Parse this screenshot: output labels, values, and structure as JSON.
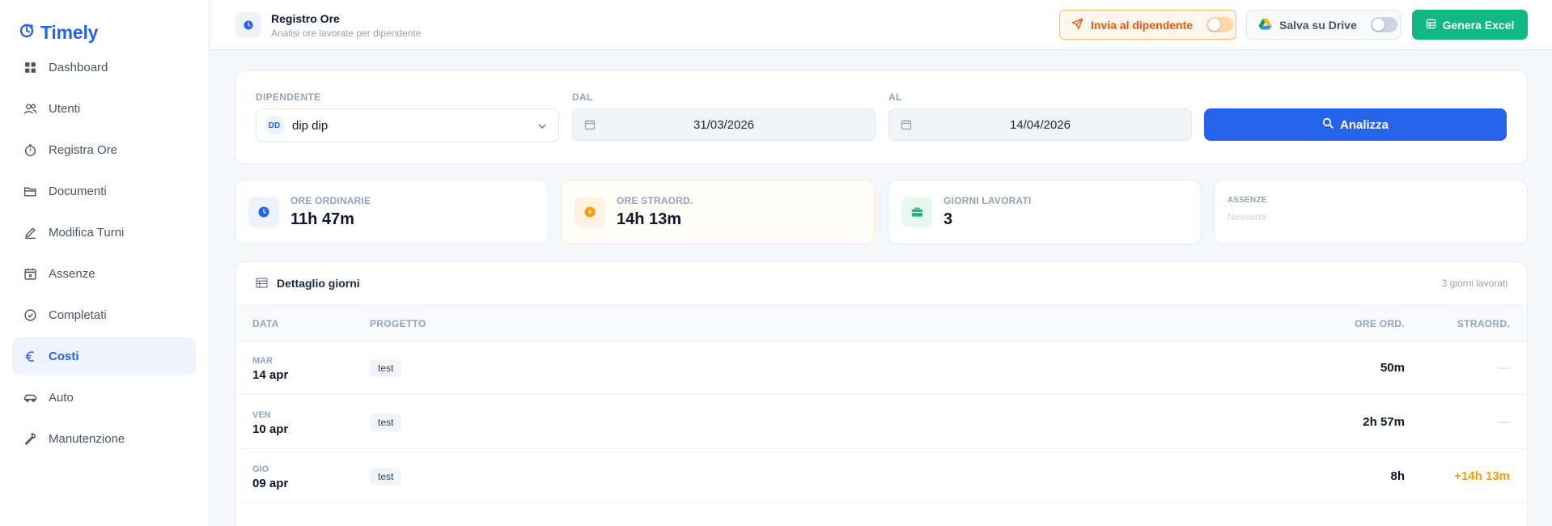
{
  "app": {
    "name": "Timely"
  },
  "sidebar": {
    "items": [
      {
        "label": "Dashboard",
        "icon": "grid-icon",
        "active": false
      },
      {
        "label": "Utenti",
        "icon": "users-icon",
        "active": false
      },
      {
        "label": "Registra Ore",
        "icon": "stopwatch-icon",
        "active": false
      },
      {
        "label": "Documenti",
        "icon": "folder-icon",
        "active": false
      },
      {
        "label": "Modifica Turni",
        "icon": "pencil-icon",
        "active": false
      },
      {
        "label": "Assenze",
        "icon": "calendar-x-icon",
        "active": false
      },
      {
        "label": "Completati",
        "icon": "check-circle-icon",
        "active": false
      },
      {
        "label": "Costi",
        "icon": "euro-icon",
        "active": true
      },
      {
        "label": "Auto",
        "icon": "car-icon",
        "active": false
      },
      {
        "label": "Manutenzione",
        "icon": "wrench-icon",
        "active": false
      }
    ]
  },
  "header": {
    "title": "Registro Ore",
    "subtitle": "Analisi ore lavorate per dipendente",
    "send_label": "Invia al dipendente",
    "drive_label": "Salva su Drive",
    "excel_label": "Genera Excel"
  },
  "filters": {
    "employee_label": "DIPENDENTE",
    "employee_initials": "DD",
    "employee_value": "dip dip",
    "from_label": "DAL",
    "from_value": "31/03/2026",
    "to_label": "AL",
    "to_value": "14/04/2026",
    "analyze_label": "Analizza"
  },
  "stats": {
    "ordinary": {
      "label": "ORE ORDINARIE",
      "value": "11h 47m"
    },
    "overtime": {
      "label": "ORE STRAORD.",
      "value": "14h 13m"
    },
    "days": {
      "label": "GIORNI LAVORATI",
      "value": "3"
    },
    "absences": {
      "label": "ASSENZE",
      "value": "Nessuna"
    }
  },
  "table": {
    "title": "Dettaglio giorni",
    "count": "3 giorni lavorati",
    "columns": {
      "date": "DATA",
      "project": "PROGETTO",
      "ord": "ORE ORD.",
      "straord": "STRAORD."
    },
    "rows": [
      {
        "day": "MAR",
        "date": "14 apr",
        "project": "test",
        "ord": "50m",
        "straord": "—"
      },
      {
        "day": "VEN",
        "date": "10 apr",
        "project": "test",
        "ord": "2h 57m",
        "straord": "—"
      },
      {
        "day": "GIO",
        "date": "09 apr",
        "project": "test",
        "ord": "8h",
        "straord": "+14h 13m"
      }
    ]
  },
  "colors": {
    "accent": "#2563eb",
    "success": "#10b981",
    "warning": "#f59e0b",
    "send": "#ea580c"
  }
}
